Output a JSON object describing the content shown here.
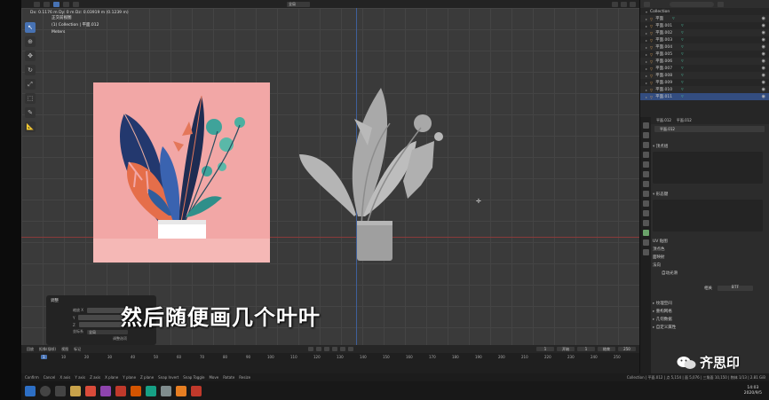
{
  "viewport": {
    "stats": "Dx: 0.1176 m   Dy: 0 m   Dz: 0.03919 m (0.1239 m)",
    "view_name": "正交前视图",
    "collection_path": "(1) Collection | 平面.012",
    "units": "Meters",
    "mode_label": "全局",
    "subtitle": "然后随便画几个叶叶"
  },
  "operator_panel": {
    "title": "调整",
    "label_1": "缩放 X",
    "label_2": "Y",
    "label_3": "Z",
    "label_4": "坐标系",
    "select_value": "全局",
    "footer": "调整选项"
  },
  "outliner": {
    "collection": "Collection",
    "items": [
      "平面",
      "平面.001",
      "平面.002",
      "平面.003",
      "平面.004",
      "平面.005",
      "平面.006",
      "平面.007",
      "平面.008",
      "平面.009",
      "平面.010",
      "平面.011"
    ]
  },
  "properties": {
    "header_left": "平面.012",
    "header_right": "平面.012",
    "object_name": "平面.012",
    "sections": [
      "顶点组",
      "形态键",
      "UV 贴图",
      "顶点色",
      "面映射",
      "法向"
    ],
    "sub_item": "自动光滑",
    "lower_sections": [
      "纹理空间",
      "重构网格",
      "几何数据",
      "自定义属性"
    ],
    "attr_label": "相关",
    "attr_value": "BTF"
  },
  "timeline": {
    "menu": [
      "回放",
      "抠像(插帧)",
      "视图",
      "标记"
    ],
    "ruler": [
      "1",
      "10",
      "20",
      "30",
      "40",
      "50",
      "60",
      "70",
      "80",
      "90",
      "100",
      "110",
      "120",
      "130",
      "140",
      "150",
      "160",
      "170",
      "180",
      "190",
      "200",
      "210",
      "220",
      "230",
      "240",
      "250"
    ],
    "current_frame": "1",
    "frame_fields": [
      "1",
      "开始",
      "1",
      "结束",
      "250"
    ]
  },
  "statusbar": {
    "items": [
      "Confirm",
      "Cancel",
      "X axis",
      "Y axis",
      "Z axis",
      "X plane",
      "Y plane",
      "Z plane",
      "Snap Invert",
      "Snap Toggle",
      "Move",
      "Rotate",
      "Resize"
    ],
    "right": "Collection | 平面.012 | 点 5,154 | 面 5,076 | 三角面 10,150 | 物体 1/13 | 2.81 GiB"
  },
  "taskbar": {
    "time": "14:03",
    "date": "2020/9/5"
  },
  "watermark": {
    "text": "齐思印"
  },
  "colors": {
    "accent": "#4772b3",
    "viewport_bg": "#3a3a3a",
    "reference_bg": "#f2a7a6"
  }
}
